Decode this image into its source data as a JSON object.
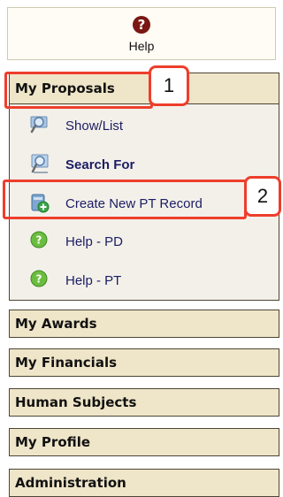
{
  "help": {
    "label": "Help",
    "icon": "question-circle-icon"
  },
  "my_proposals": {
    "title": "My Proposals",
    "items": [
      {
        "label": "Show/List",
        "icon": "magnifier-list-icon"
      },
      {
        "label": "Search For",
        "icon": "magnifier-search-icon"
      },
      {
        "label": "Create New PT Record",
        "icon": "new-record-icon"
      },
      {
        "label": "Help - PD",
        "icon": "green-help-icon"
      },
      {
        "label": "Help - PT",
        "icon": "green-help-icon"
      }
    ]
  },
  "sections": [
    "My Awards",
    "My Financials",
    "Human Subjects",
    "My Profile",
    "Administration"
  ],
  "callouts": {
    "one": "1",
    "two": "2"
  },
  "colors": {
    "section_bg": "#efe5c8",
    "link": "#1b1d63",
    "callout": "#ee3e2c"
  }
}
